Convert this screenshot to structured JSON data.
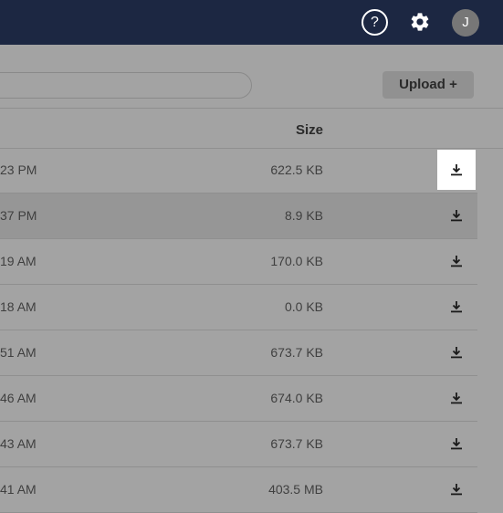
{
  "topbar": {
    "help_icon": "question-circle-icon",
    "help_glyph": "?",
    "settings_icon": "gear-icon",
    "avatar_initial": "J",
    "background_color": "#1c2742"
  },
  "toolbar": {
    "upload_label": "Upload +"
  },
  "table": {
    "columns": {
      "size": "Size"
    },
    "download_icon": "download-icon",
    "rows": [
      {
        "date": "23 PM",
        "size": "622.5 KB"
      },
      {
        "date": "37 PM",
        "size": "8.9 KB"
      },
      {
        "date": "19 AM",
        "size": "170.0 KB"
      },
      {
        "date": "18 AM",
        "size": "0.0 KB"
      },
      {
        "date": "51 AM",
        "size": "673.7 KB"
      },
      {
        "date": "46 AM",
        "size": "674.0 KB"
      },
      {
        "date": "43 AM",
        "size": "673.7 KB"
      },
      {
        "date": "41 AM",
        "size": "403.5 MB"
      }
    ]
  }
}
